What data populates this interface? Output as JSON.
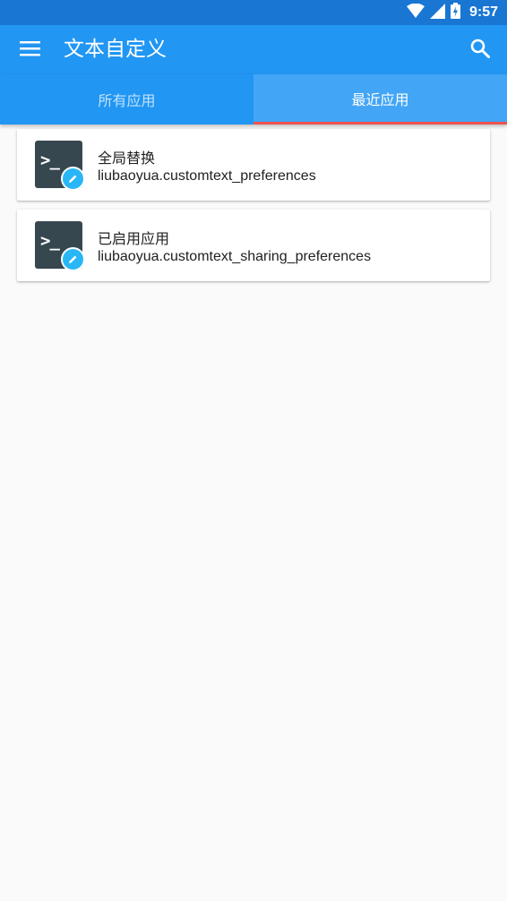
{
  "status_bar": {
    "time": "9:57",
    "icons": [
      "wifi-icon",
      "signal-icon",
      "battery-icon"
    ]
  },
  "app_bar": {
    "menu_icon": "menu-icon",
    "title": "文本自定义",
    "search_icon": "search-icon"
  },
  "tabs": [
    {
      "label": "所有应用",
      "selected": false
    },
    {
      "label": "最近应用",
      "selected": true
    }
  ],
  "items": [
    {
      "title": "全局替换",
      "subtitle": "liubaoyua.customtext_preferences",
      "icon": "terminal-app-icon"
    },
    {
      "title": "已启用应用",
      "subtitle": "liubaoyua.customtext_sharing_preferences",
      "icon": "terminal-app-icon"
    }
  ],
  "colors": {
    "status_bar": "#1976d2",
    "primary": "#2196f3",
    "selected_tab": "#42a5f5",
    "tab_indicator": "#ef5350",
    "background": "#fafafa",
    "badge": "#29b6f6"
  }
}
